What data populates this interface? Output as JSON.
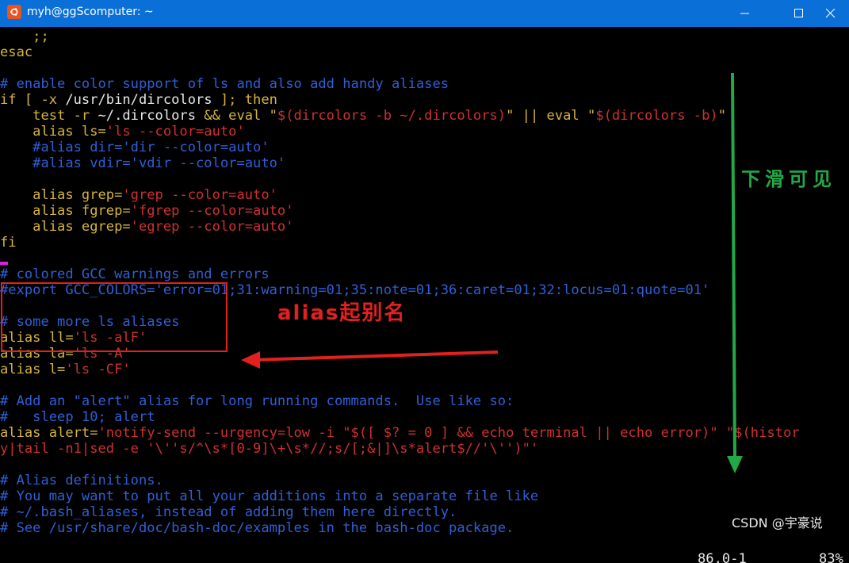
{
  "window": {
    "title": "myh@ggScomputer: ~",
    "icon": "ubuntu-terminal-icon",
    "buttons": [
      "minimize-icon",
      "maximize-icon",
      "close-icon"
    ]
  },
  "colors": {
    "titlebar": "#0a6fd6",
    "comment": "#2f5fd8",
    "keyword": "#d6b43c",
    "string": "#d03030",
    "text": "#e8e8e8",
    "annotation_red": "#e22020",
    "annotation_green": "#22a846",
    "cursor": "#e020e0"
  },
  "editor": {
    "lines": [
      [
        {
          "t": "    ;;",
          "c": "kw"
        }
      ],
      [
        {
          "t": "esac",
          "c": "kw"
        }
      ],
      [],
      [
        {
          "t": "# enable color support of ls and also add handy aliases",
          "c": "comment"
        }
      ],
      [
        {
          "t": "if [ ",
          "c": "kw"
        },
        {
          "t": "-x",
          "c": "kw"
        },
        {
          "t": " /usr/bin/dircolors ",
          "c": "default"
        },
        {
          "t": "]; then",
          "c": "kw"
        }
      ],
      [
        {
          "t": "    test -r ",
          "c": "kw"
        },
        {
          "t": "~/.dircolors ",
          "c": "default"
        },
        {
          "t": "&& eval \"",
          "c": "kw"
        },
        {
          "t": "$(dircolors -b ~/.dircolors)",
          "c": "str"
        },
        {
          "t": "\" || eval \"",
          "c": "kw"
        },
        {
          "t": "$(dircolors -b)",
          "c": "str"
        },
        {
          "t": "\"",
          "c": "kw"
        }
      ],
      [
        {
          "t": "    alias ls=",
          "c": "kw"
        },
        {
          "t": "'ls --color=auto'",
          "c": "str"
        }
      ],
      [
        {
          "t": "    #alias dir='dir --color=auto'",
          "c": "comment"
        }
      ],
      [
        {
          "t": "    #alias vdir='vdir --color=auto'",
          "c": "comment"
        }
      ],
      [],
      [
        {
          "t": "    alias grep=",
          "c": "kw"
        },
        {
          "t": "'grep --color=auto'",
          "c": "str"
        }
      ],
      [
        {
          "t": "    alias fgrep=",
          "c": "kw"
        },
        {
          "t": "'fgrep --color=auto'",
          "c": "str"
        }
      ],
      [
        {
          "t": "    alias egrep=",
          "c": "kw"
        },
        {
          "t": "'egrep --color=auto'",
          "c": "str"
        }
      ],
      [
        {
          "t": "fi",
          "c": "kw"
        }
      ],
      [],
      [
        {
          "t": "# colored GCC warnings and errors",
          "c": "comment"
        }
      ],
      [
        {
          "t": "#export GCC_COLORS='error=01;31:warning=01;35:note=01;36:caret=01;32:locus=01:quote=01'",
          "c": "comment"
        }
      ],
      [],
      [
        {
          "t": "# some more ls aliases",
          "c": "comment"
        }
      ],
      [
        {
          "t": "alias ll=",
          "c": "kw"
        },
        {
          "t": "'ls -alF'",
          "c": "str"
        }
      ],
      [
        {
          "t": "alias la=",
          "c": "kw"
        },
        {
          "t": "'ls -A'",
          "c": "str"
        }
      ],
      [
        {
          "t": "alias l=",
          "c": "kw"
        },
        {
          "t": "'ls -CF'",
          "c": "str"
        }
      ],
      [],
      [
        {
          "t": "# Add an \"alert\" alias for long running commands.  Use like so:",
          "c": "comment"
        }
      ],
      [
        {
          "t": "#   sleep 10; alert",
          "c": "comment"
        }
      ],
      [
        {
          "t": "alias alert=",
          "c": "kw"
        },
        {
          "t": "'notify-send --urgency=low -i \"$([ $? = 0 ] && echo terminal || echo error)\" \"$(histor",
          "c": "str"
        }
      ],
      [
        {
          "t": "y|tail -n1|sed -e '\\''s/^\\s*[0-9]\\+\\s*//;s/[;&|]\\s*alert$//'\\'')\"'",
          "c": "str"
        }
      ],
      [],
      [
        {
          "t": "# Alias definitions.",
          "c": "comment"
        }
      ],
      [
        {
          "t": "# You may want to put all your additions into a separate file like",
          "c": "comment"
        }
      ],
      [
        {
          "t": "# ~/.bash_aliases, instead of adding them here directly.",
          "c": "comment"
        }
      ],
      [
        {
          "t": "# See /usr/share/doc/bash-doc/examples in the bash-doc package.",
          "c": "comment"
        }
      ]
    ],
    "status_position": "86,0-1",
    "status_percent": "83%"
  },
  "annotations": {
    "red_label": "alias起别名",
    "green_label": "下滑可见"
  },
  "watermark": "CSDN @宇豪说"
}
